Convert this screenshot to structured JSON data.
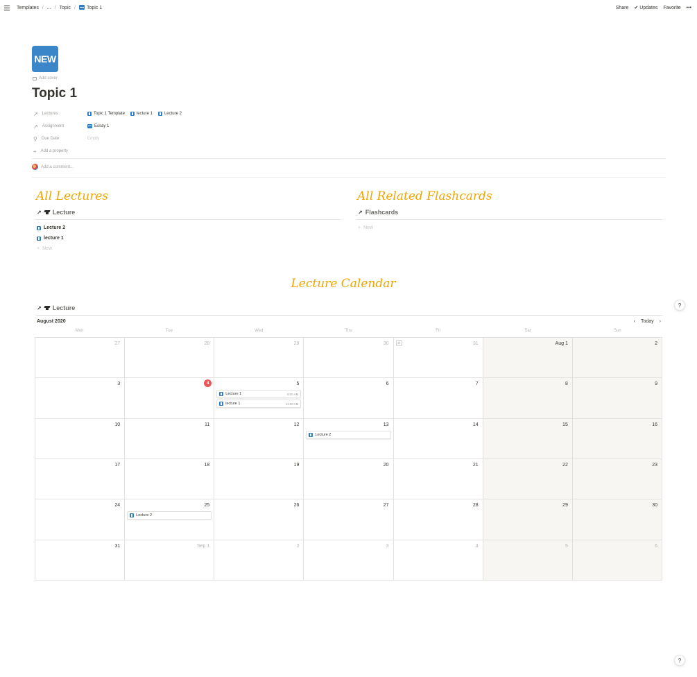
{
  "breadcrumb": [
    "Templates",
    "...",
    "Topic",
    "Topic 1"
  ],
  "topbar": {
    "share": "Share",
    "updates": "Updates",
    "favorite": "Favorite",
    "more": "•••"
  },
  "page": {
    "icon_text": "NEW",
    "add_cover": "Add cover",
    "title": "Topic 1",
    "comment_placeholder": "Add a comment..."
  },
  "properties": {
    "lectures": {
      "label": "Lectures",
      "values": [
        "Topic 1 Template",
        "lecture 1",
        "Lecture 2"
      ]
    },
    "assignment": {
      "label": "Assignment",
      "value": "Essay 1"
    },
    "due_date": {
      "label": "Due Date",
      "value": "Empty"
    },
    "add_property": "Add a property"
  },
  "sections": {
    "lectures_heading": "All Lectures",
    "flashcards_heading": "All Related Flashcards",
    "calendar_heading": "Lecture Calendar"
  },
  "lectures_db": {
    "title": "Lecture",
    "items": [
      "Lecture 2",
      "lecture 1"
    ],
    "new_label": "New"
  },
  "flashcards_db": {
    "title": "Flashcards",
    "new_label": "New"
  },
  "calendar": {
    "db_title": "Lecture",
    "month": "August 2020",
    "today_label": "Today",
    "weekdays": [
      "Mon",
      "Tue",
      "Wed",
      "Thu",
      "Fri",
      "Sat",
      "Sun"
    ],
    "today_day": "4",
    "weeks": [
      [
        {
          "d": "27",
          "dim": true
        },
        {
          "d": "28",
          "dim": true
        },
        {
          "d": "29",
          "dim": true
        },
        {
          "d": "30",
          "dim": true
        },
        {
          "d": "31",
          "dim": true,
          "plus": true
        },
        {
          "d": "Aug 1"
        },
        {
          "d": "2"
        }
      ],
      [
        {
          "d": "3"
        },
        {
          "d": "4",
          "today": true
        },
        {
          "d": "5",
          "events": [
            {
              "title": "Lecture 1",
              "time": "9:00 AM"
            },
            {
              "title": "lecture 1",
              "time": "11:00 AM"
            }
          ]
        },
        {
          "d": "6"
        },
        {
          "d": "7"
        },
        {
          "d": "8"
        },
        {
          "d": "9"
        }
      ],
      [
        {
          "d": "10"
        },
        {
          "d": "11"
        },
        {
          "d": "12"
        },
        {
          "d": "13",
          "events": [
            {
              "title": "Lecture 2",
              "time": ""
            }
          ]
        },
        {
          "d": "14"
        },
        {
          "d": "15"
        },
        {
          "d": "16"
        }
      ],
      [
        {
          "d": "17"
        },
        {
          "d": "18"
        },
        {
          "d": "19"
        },
        {
          "d": "20"
        },
        {
          "d": "21"
        },
        {
          "d": "22"
        },
        {
          "d": "23"
        }
      ],
      [
        {
          "d": "24"
        },
        {
          "d": "25",
          "events": [
            {
              "title": "Lecture 2",
              "time": ""
            }
          ]
        },
        {
          "d": "26"
        },
        {
          "d": "27"
        },
        {
          "d": "28"
        },
        {
          "d": "29"
        },
        {
          "d": "30"
        }
      ],
      [
        {
          "d": "31"
        },
        {
          "d": "Sep 1",
          "dim": true
        },
        {
          "d": "2",
          "dim": true
        },
        {
          "d": "3",
          "dim": true
        },
        {
          "d": "4",
          "dim": true
        },
        {
          "d": "5",
          "dim": true
        },
        {
          "d": "6",
          "dim": true
        }
      ]
    ]
  },
  "help": "?",
  "colors": {
    "accent_heading": "#f0a500",
    "today_badge": "#eb5757",
    "icon_blue": "#2f7dc5",
    "weekend_bg": "#f7f6f3"
  }
}
